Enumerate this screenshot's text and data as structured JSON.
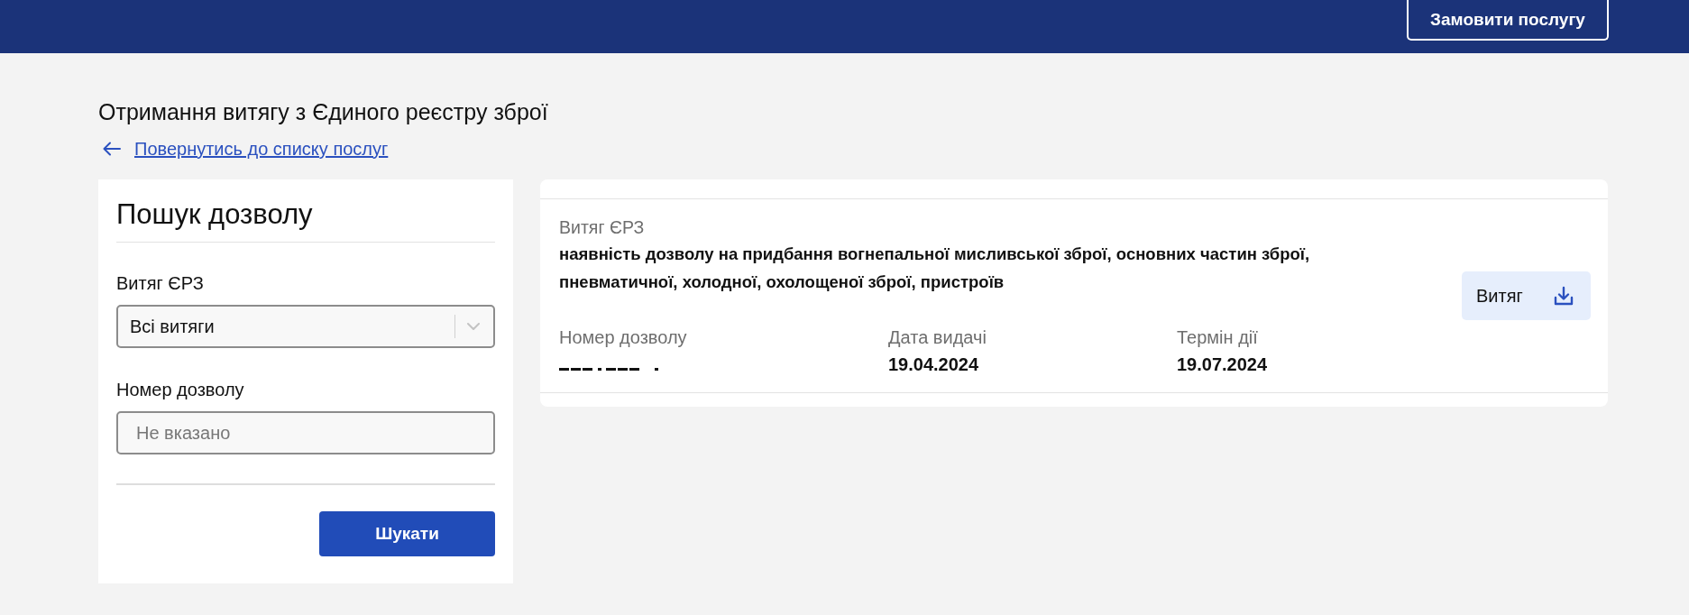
{
  "header": {
    "order_button": "Замовити послугу"
  },
  "page": {
    "title": "Отримання витягу з Єдиного реєстру зброї",
    "back_link": "Повернутись до списку послуг"
  },
  "search_panel": {
    "title": "Пошук дозволу",
    "fields": [
      {
        "kind": "select",
        "label": "Витяг ЄРЗ",
        "value": "Всі витяги"
      },
      {
        "kind": "text",
        "label": "Номер дозволу",
        "placeholder": "Не вказано"
      }
    ],
    "submit_button": "Шукати"
  },
  "results": [
    {
      "type_label": "Витяг ЄРЗ",
      "description": "наявність дозволу на придбання вогнепальної мисливської зброї, основних частин зброї, пневматичної, холодної, охолощеної зброї, пристроїв",
      "details": [
        {
          "label": "Номер дозволу",
          "obscured": true
        },
        {
          "label": "Дата видачі",
          "value": "19.04.2024",
          "obscured": false
        },
        {
          "label": "Термін дії",
          "value": "19.07.2024",
          "obscured": false
        }
      ],
      "download_button": "Витяг"
    }
  ]
}
